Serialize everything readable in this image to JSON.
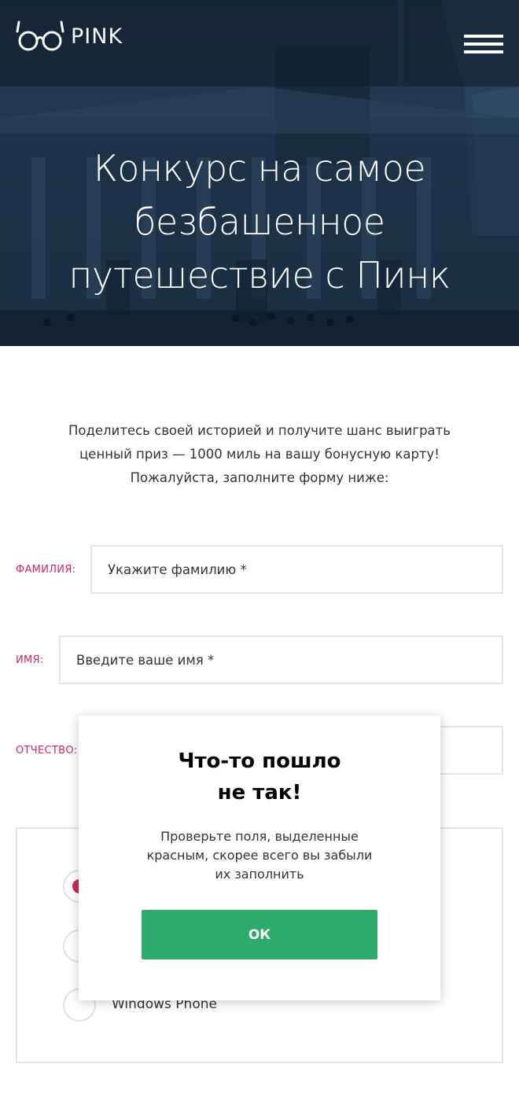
{
  "header": {
    "logo_text": "PINK",
    "hero_title_lines": [
      "Конкурс на самое",
      "безбашенное",
      "путешествие с Пинк"
    ]
  },
  "intro": {
    "lines": [
      "Поделитесь своей историей и получите шанс выиграть",
      "ценный приз — 1000 миль на вашу бонусную карту!",
      "Пожалуйста, заполните форму ниже:"
    ]
  },
  "form": {
    "surname": {
      "label": "фамилия:",
      "placeholder": "Укажите фамилию *"
    },
    "name": {
      "label": "имя:",
      "placeholder": "Введите ваше имя *"
    },
    "patronymic": {
      "label": "отчество:",
      "placeholder": ""
    },
    "os_options": [
      {
        "label": "",
        "checked": true
      },
      {
        "label": "",
        "checked": false
      },
      {
        "label": "Windows Phone",
        "checked": false
      }
    ]
  },
  "modal": {
    "title_lines": [
      "Что-то пошло",
      "не так!"
    ],
    "text_lines": [
      "Проверьте поля, выделенные",
      "красным, скорее всего вы забыли",
      "их заполнить"
    ],
    "ok_label": "ок"
  },
  "colors": {
    "accent": "#d22856",
    "ok_button": "#2dab6b",
    "hero_overlay": "#1e3246"
  }
}
